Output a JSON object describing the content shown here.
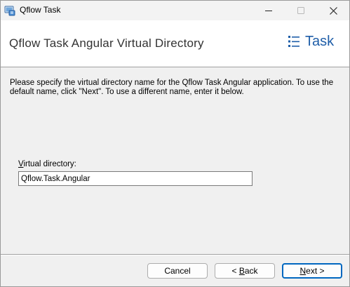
{
  "window": {
    "title": "Qflow Task"
  },
  "icons": {
    "app": "installer-app-icon",
    "minimize": "minimize-icon",
    "maximize": "maximize-icon",
    "close": "close-icon",
    "logo": "task-list-logo-icon"
  },
  "colors": {
    "accent": "#0067c0",
    "logo": "#1f5ea8"
  },
  "header": {
    "title": "Qflow Task Angular Virtual Directory",
    "logo_text": "Task"
  },
  "main": {
    "description": "Please specify the virtual directory name for the Qflow Task Angular application.  To use the default name, click \"Next\". To use a different name, enter it below.",
    "field": {
      "label_hotkey": "V",
      "label_rest": "irtual directory:",
      "value": "Qflow.Task.Angular"
    }
  },
  "footer": {
    "cancel_label": "Cancel",
    "back_prefix": "< ",
    "back_hotkey": "B",
    "back_rest": "ack",
    "next_hotkey": "N",
    "next_rest": "ext >"
  }
}
